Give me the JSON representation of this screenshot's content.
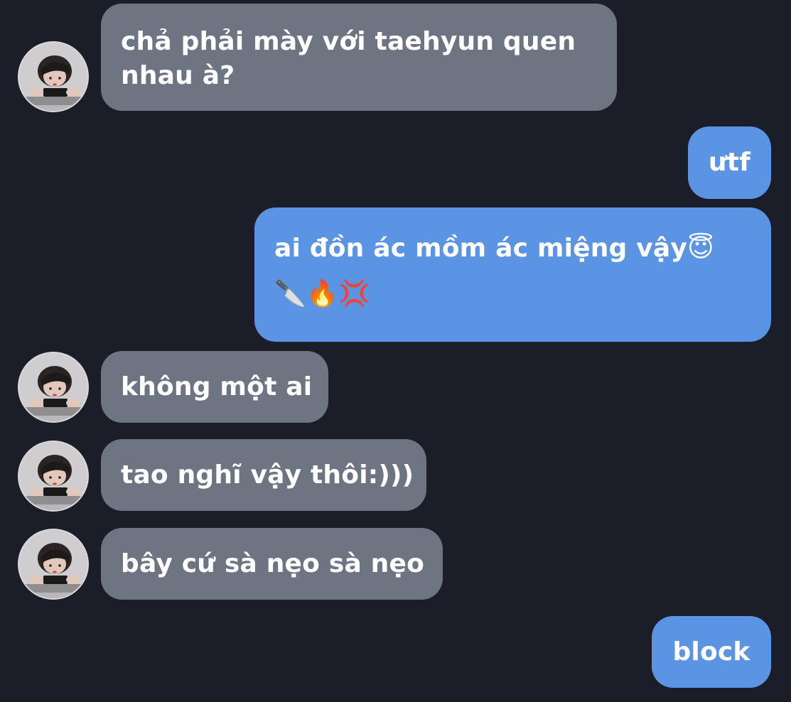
{
  "conversation": {
    "messages": [
      {
        "side": "received",
        "text": "chả phải mày với taehyun quen nhau à?"
      },
      {
        "side": "sent",
        "text": "ưtf"
      },
      {
        "side": "sent",
        "text": "ai đồn ác mồm ác miệng vậy😇🔪🔥💢"
      },
      {
        "side": "received",
        "text": "không một ai"
      },
      {
        "side": "received",
        "text": "tao nghĩ vậy thôi:)))"
      },
      {
        "side": "received",
        "text": "bây cứ sà nẹo sà nẹo"
      },
      {
        "side": "sent",
        "text": "block"
      }
    ]
  },
  "colors": {
    "background": "#1b1e29",
    "received_bubble": "#6d7482",
    "sent_bubble": "#5a94e3",
    "text": "#ffffff"
  },
  "icons": {
    "avatar": "contact-avatar-photo"
  }
}
